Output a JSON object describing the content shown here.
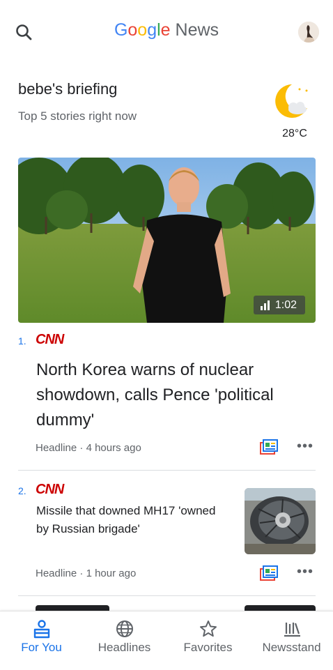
{
  "header": {
    "logo_google": [
      "G",
      "o",
      "o",
      "g",
      "l",
      "e"
    ],
    "logo_news": "News"
  },
  "briefing": {
    "title": "bebe's briefing",
    "subtitle": "Top 5 stories right now",
    "temperature": "28°C",
    "weather_icon": "moon-cloud-icon"
  },
  "stories": [
    {
      "number": "1.",
      "source": "CNN",
      "title": "North Korea warns of nuclear showdown, calls Pence 'political dummy'",
      "label": "Headline",
      "time": "4 hours ago",
      "video_duration": "1:02"
    },
    {
      "number": "2.",
      "source": "CNN",
      "title": "Missile that downed MH17 'owned by Russian brigade'",
      "label": "Headline",
      "time": "1 hour ago"
    }
  ],
  "more_glyph": "•••",
  "meta_sep": "·",
  "bottom_nav": {
    "items": [
      {
        "label": "For You",
        "icon": "for-you-icon",
        "active": true
      },
      {
        "label": "Headlines",
        "icon": "globe-icon",
        "active": false
      },
      {
        "label": "Favorites",
        "icon": "star-icon",
        "active": false
      },
      {
        "label": "Newsstand",
        "icon": "newsstand-icon",
        "active": false
      }
    ]
  },
  "colors": {
    "accent": "#1a73e8",
    "cnn_red": "#cc0000",
    "text_primary": "#202124",
    "text_secondary": "#5f6368"
  }
}
